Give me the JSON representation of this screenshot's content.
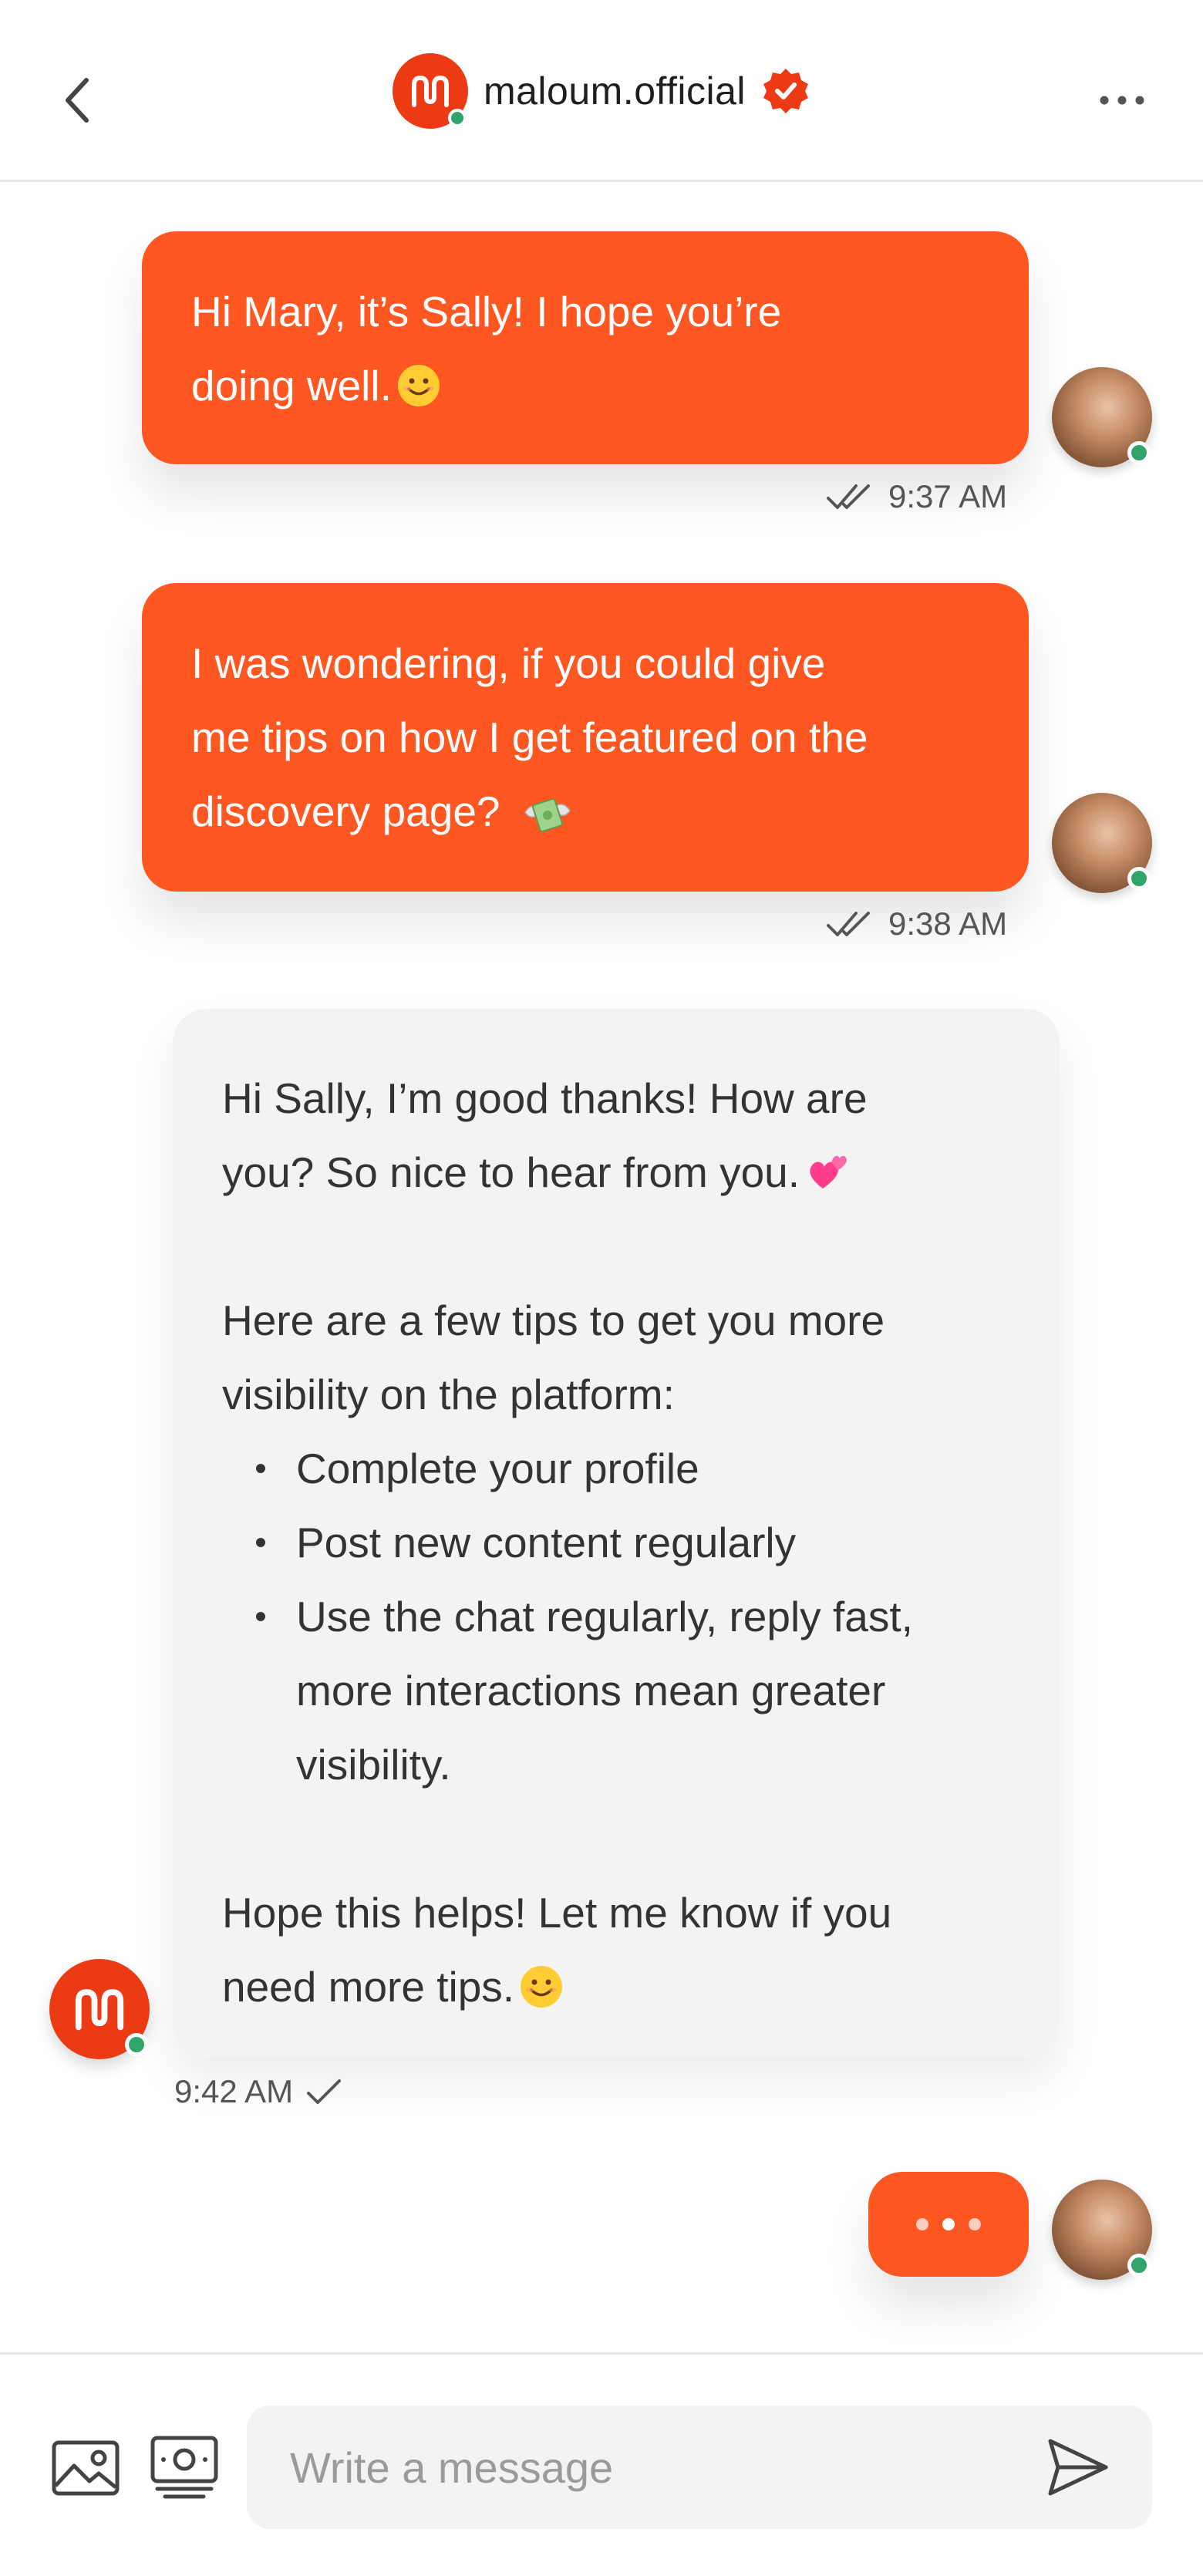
{
  "header": {
    "title": "maloum.official",
    "icons": {
      "back": "chevron-left-icon",
      "more": "more-horizontal-icon",
      "verified": "verified-badge-icon"
    },
    "online_status_color": "#2fa56b"
  },
  "colors": {
    "accent": "#ff5722",
    "brand": "#ec3b14",
    "incoming_bubble": "#f3f3f3",
    "online": "#2fa56b"
  },
  "messages": [
    {
      "direction": "outgoing",
      "lines": [
        "Hi Mary, it’s Sally! I hope you’re",
        "doing well."
      ],
      "emoji": "smiling-face-emoji",
      "time": "9:37 AM",
      "status": "read"
    },
    {
      "direction": "outgoing",
      "lines": [
        "I was wondering, if you could give",
        "me tips on how I get featured on the",
        "discovery page?"
      ],
      "emoji": "money-with-wings-emoji",
      "time": "9:38 AM",
      "status": "read"
    },
    {
      "direction": "incoming",
      "intro": [
        "Hi Sally, I’m good thanks! How are",
        "you? So nice to hear from you."
      ],
      "intro_emoji": "two-hearts-emoji",
      "tips_intro": [
        "Here are a few tips to get you more",
        "visibility on the platform:"
      ],
      "tips": [
        "Complete your profile",
        "Post new content regularly",
        "Use the chat regularly, reply fast, more interactions mean greater visibility."
      ],
      "tip3_lines": [
        "Use the chat regularly, reply fast,",
        "more interactions mean greater",
        "visibility."
      ],
      "outro": [
        "Hope this helps! Let me know if you",
        "need more tips."
      ],
      "outro_emoji": "smiling-face-emoji",
      "time": "9:42 AM",
      "status": "sent"
    }
  ],
  "typing_indicator": {
    "visible": true
  },
  "composer": {
    "placeholder": "Write a message",
    "value": "",
    "icons": {
      "image": "image-icon",
      "money": "money-icon",
      "send": "send-icon"
    }
  }
}
